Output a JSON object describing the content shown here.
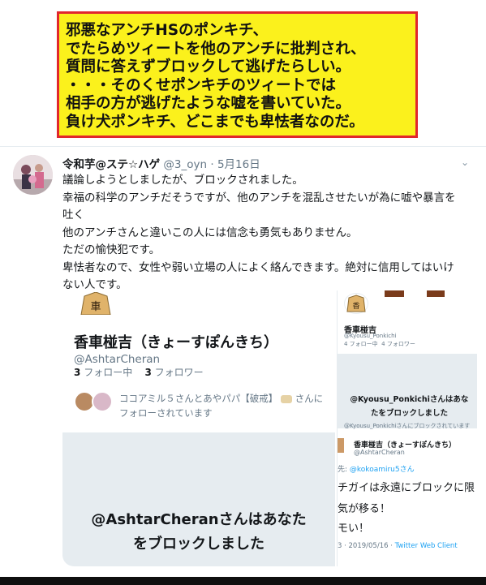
{
  "caption": {
    "lines": [
      "邪悪なアンチHSのポンキチ、",
      "でたらめツィートを他のアンチに批判され、",
      "質問に答えずブロックして逃げたらしい。",
      "・・・そのくせポンキチのツィートでは",
      "相手の方が逃げたような嘘を書いていた。",
      "負け犬ポンキチ、どこまでも卑怯者なのだ。"
    ]
  },
  "tweet": {
    "name": "令和芋@ステ☆ハゲ",
    "handle": "@3_oyn",
    "separator": "·",
    "date": "5月16日",
    "body": [
      "議論しようとしましたが、ブロックされました。",
      "幸福の科学のアンチだそうですが、他のアンチを混乱させたいが為に嘘や暴言を",
      "吐く",
      "他のアンチさんと違いこの人には信念も勇気もありません。",
      "ただの愉快犯です。",
      "卑怯者なので、女性や弱い立場の人によく絡んできます。絶対に信用してはいけ",
      "ない人です。"
    ]
  },
  "media_left": {
    "piece_char": "香車",
    "name": "香車椪吉（きょーすぽんきち）",
    "handle": "@AshtarCheran",
    "following_count": "3",
    "following_label": "フォロー中",
    "followers_count": "3",
    "followers_label": "フォロワー",
    "followed_by": "ココアミル５さんとあやパパ【破戒】",
    "followed_by_suffix": "さんにフォローされています",
    "blocked_line1": "@AshtarCheranさんはあなた",
    "blocked_line2": "をブロックしました"
  },
  "media_right": {
    "name": "香車椪吉",
    "handle": "@Kyousu_Ponkichi",
    "following": "4 フォロー中",
    "followers": "4 フォロワー",
    "blocked_line1": "@Kyousu_Ponkichiさんはあな",
    "blocked_line2": "たをブロックしました",
    "blocked_sub": "@Kyousu_Ponkichiさんにブロックされています",
    "tw_name": "香車椪吉（きょーすぽんきち）",
    "tw_handle": "@AshtarCheran",
    "reply_prefix": "先: ",
    "reply_to": "@kokoamiru5さん",
    "line1": "チガイは永遠にブロックに限",
    "line2": "気が移る！",
    "line3": "モい！",
    "date": "3 · 2019/05/16 · ",
    "client": "Twitter Web Client"
  },
  "colors": {
    "caption_bg": "#fbf11c",
    "caption_border": "#e1272d",
    "link_blue": "#1da1f2",
    "muted": "#657786"
  }
}
